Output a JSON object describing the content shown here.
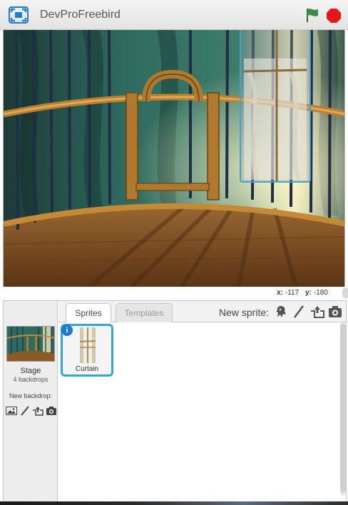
{
  "header": {
    "project_title": "DevProFreebird",
    "icons": [
      "fullscreen-icon",
      "green-flag-icon",
      "stop-icon"
    ],
    "colors": {
      "stop": "#e8151b",
      "flag": "#3e8e41",
      "selection": "#3fa2d6"
    }
  },
  "stage": {
    "scene": "birdcage-with-curtain",
    "coordinates": {
      "x_label": "x:",
      "x_value": "-117",
      "y_label": "y:",
      "y_value": "-180"
    }
  },
  "stage_panel": {
    "label": "Stage",
    "backdrops": "4 backdrops",
    "new_backdrop_label": "New backdrop:",
    "icons": [
      "paint-library-icon",
      "paintbrush-icon",
      "upload-icon",
      "camera-icon"
    ]
  },
  "tabs": {
    "sprites": "Sprites",
    "templates": "Templates"
  },
  "new_sprite": {
    "label": "New sprite:",
    "icons": [
      "sprite-library-icon",
      "paintbrush-icon",
      "upload-icon",
      "camera-icon"
    ]
  },
  "sprites": [
    {
      "name": "Curtain",
      "selected": true,
      "info": "i"
    }
  ]
}
